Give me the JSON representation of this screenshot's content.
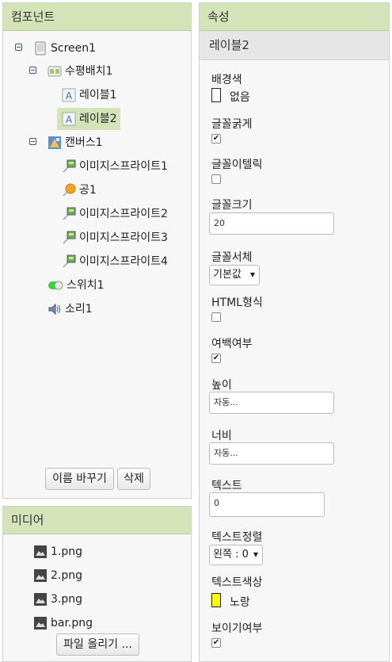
{
  "components": {
    "title": "컴포넌트",
    "tree": {
      "screen": "Screen1",
      "arrangement": "수평배치1",
      "label1": "레이블1",
      "label2": "레이블2",
      "canvas": "캔버스1",
      "sprite1": "이미지스프라이트1",
      "ball": "공1",
      "sprite2": "이미지스프라이트2",
      "sprite3": "이미지스프라이트3",
      "sprite4": "이미지스프라이트4",
      "switch": "스위치1",
      "sound": "소리1"
    },
    "rename_button": "이름 바꾸기",
    "delete_button": "삭제"
  },
  "media": {
    "title": "미디어",
    "files": [
      "1.png",
      "2.png",
      "3.png",
      "bar.png"
    ],
    "upload_button": "파일 올리기 ..."
  },
  "properties": {
    "title": "속성",
    "selected": "레이블2",
    "background_color_label": "배경색",
    "background_color_value": "없음",
    "bold_label": "글꼴굵게",
    "bold_checked": true,
    "italic_label": "글꼴이텔릭",
    "italic_checked": false,
    "fontsize_label": "글꼴크기",
    "fontsize_value": "20",
    "typeface_label": "글꼴서체",
    "typeface_value": "기본값",
    "html_label": "HTML형식",
    "html_checked": false,
    "margin_label": "여백여부",
    "margin_checked": true,
    "height_label": "높이",
    "height_value": "자동...",
    "width_label": "너비",
    "width_value": "자동...",
    "text_label": "텍스트",
    "text_value": "0",
    "textalign_label": "텍스트정렬",
    "textalign_value": "왼쪽 : 0",
    "textcolor_label": "텍스트색상",
    "textcolor_value": "노랑",
    "textcolor_hex": "#ffff00",
    "visible_label": "보이기여부",
    "visible_checked": true
  },
  "colors": {
    "header_bg": "#d4e3b8",
    "selected_bg": "#d4e3b8"
  }
}
